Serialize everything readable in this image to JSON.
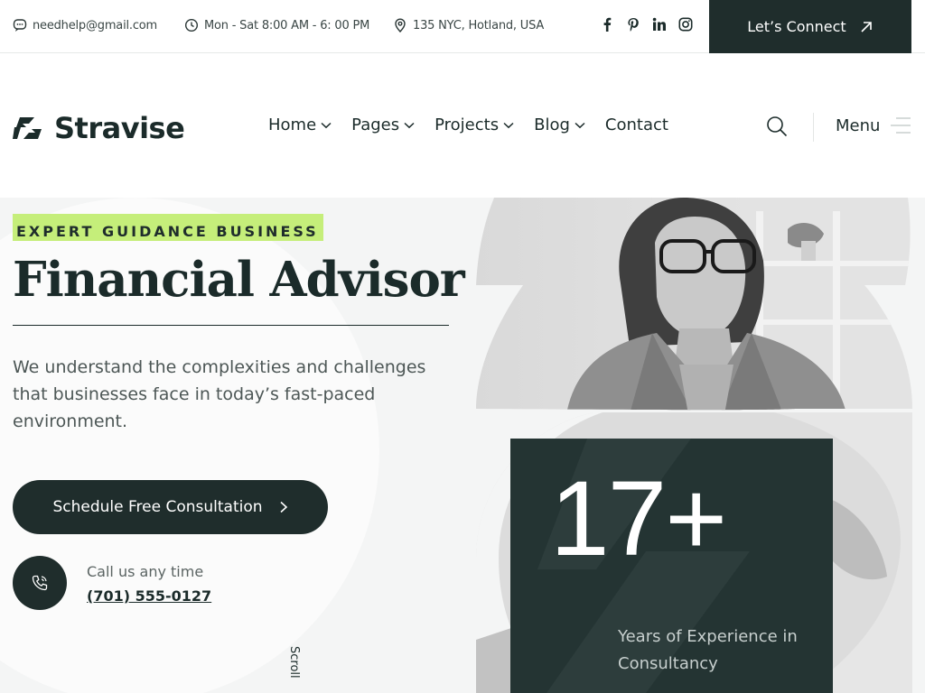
{
  "topbar": {
    "email": "needhelp@gmail.com",
    "hours": "Mon - Sat 8:00 AM - 6: 00 PM",
    "address": "135 NYC, Hotland, USA",
    "socials": [
      "facebook-icon",
      "pinterest-icon",
      "linkedin-icon",
      "instagram-icon"
    ],
    "connect_label": "Let’s Connect"
  },
  "header": {
    "logo_text": "Stravise",
    "nav": [
      {
        "label": "Home",
        "dropdown": true
      },
      {
        "label": "Pages",
        "dropdown": true
      },
      {
        "label": "Projects",
        "dropdown": true
      },
      {
        "label": "Blog",
        "dropdown": true
      },
      {
        "label": "Contact",
        "dropdown": false
      }
    ],
    "menu_label": "Menu"
  },
  "hero": {
    "eyebrow": "EXPERT GUIDANCE BUSINESS",
    "title": "Financial Advisor",
    "description": "We understand the complexities and challenges that businesses face in today’s fast-paced environment.",
    "cta_label": "Schedule Free Consultation",
    "call_label": "Call us any time",
    "call_number": "(701) 555-0127",
    "scroll_label": "Scroll",
    "stat_number": "17+",
    "stat_label": "Years of Experience in Consultancy"
  },
  "colors": {
    "dark": "#1f2d2c",
    "accent": "#c5ee7a",
    "hero_bg": "#f4f5f5"
  }
}
